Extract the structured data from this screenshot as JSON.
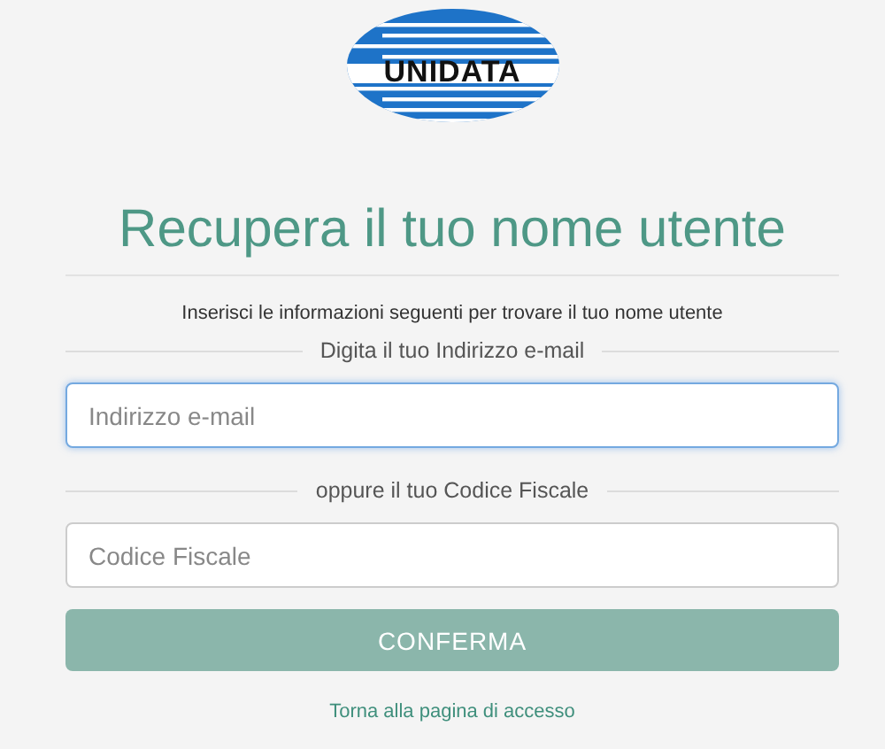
{
  "logo": {
    "text": "UNIDATA"
  },
  "title": "Recupera il tuo nome utente",
  "instruction": "Inserisci le informazioni seguenti per trovare il tuo nome utente",
  "sections": [
    {
      "divider_label": "Digita il tuo Indirizzo e-mail",
      "field": {
        "placeholder": "Indirizzo e-mail",
        "focused": true
      }
    },
    {
      "divider_label": "oppure il tuo Codice Fiscale",
      "field": {
        "placeholder": "Codice Fiscale",
        "focused": false
      }
    }
  ],
  "submit_button": "CONFERMA",
  "back_link": "Torna alla pagina di accesso"
}
